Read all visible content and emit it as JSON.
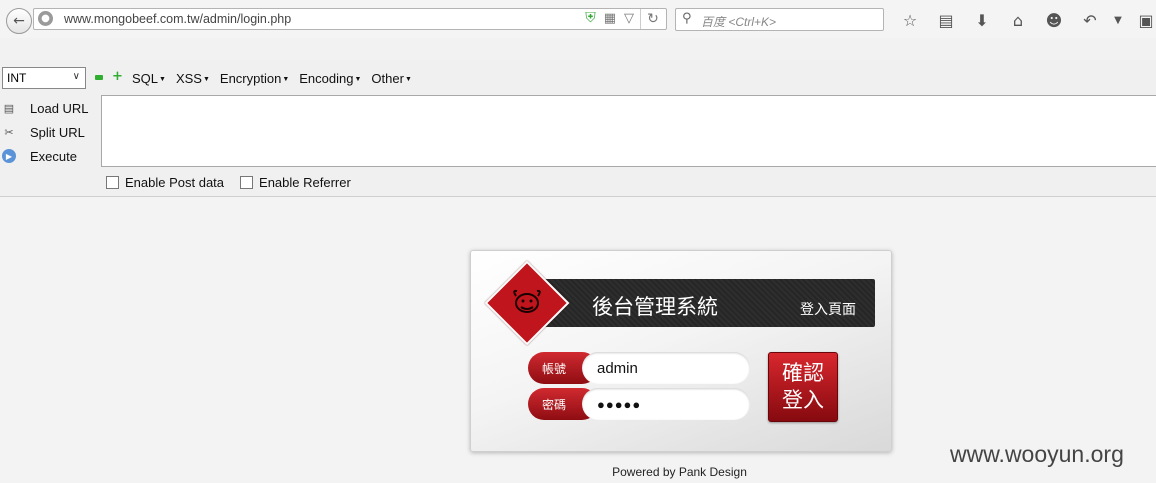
{
  "browser": {
    "url": "www.mongobeef.com.tw/admin/login.php",
    "search_placeholder": "百度 <Ctrl+K>"
  },
  "hackbar": {
    "type_select": "INT",
    "menus": [
      "SQL",
      "XSS",
      "Encryption",
      "Encoding",
      "Other"
    ],
    "actions": {
      "load": "Load URL",
      "split": "Split URL",
      "execute": "Execute"
    },
    "url_value": "",
    "options": {
      "post": "Enable Post data",
      "referrer": "Enable Referrer"
    }
  },
  "login": {
    "title": "後台管理系統",
    "subtitle": "登入頁面",
    "username_label": "帳號",
    "username_value": "admin",
    "password_label": "密碼",
    "password_masked": "●●●●●",
    "button_line1": "確認",
    "button_line2": "登入"
  },
  "footer": {
    "powered": "Powered by Pank Design"
  },
  "watermark": "www.wooyun.org",
  "colors": {
    "accent_red": "#c0151d",
    "banner_dark": "#2e2e2e",
    "hackbar_green": "#2fae2f"
  }
}
